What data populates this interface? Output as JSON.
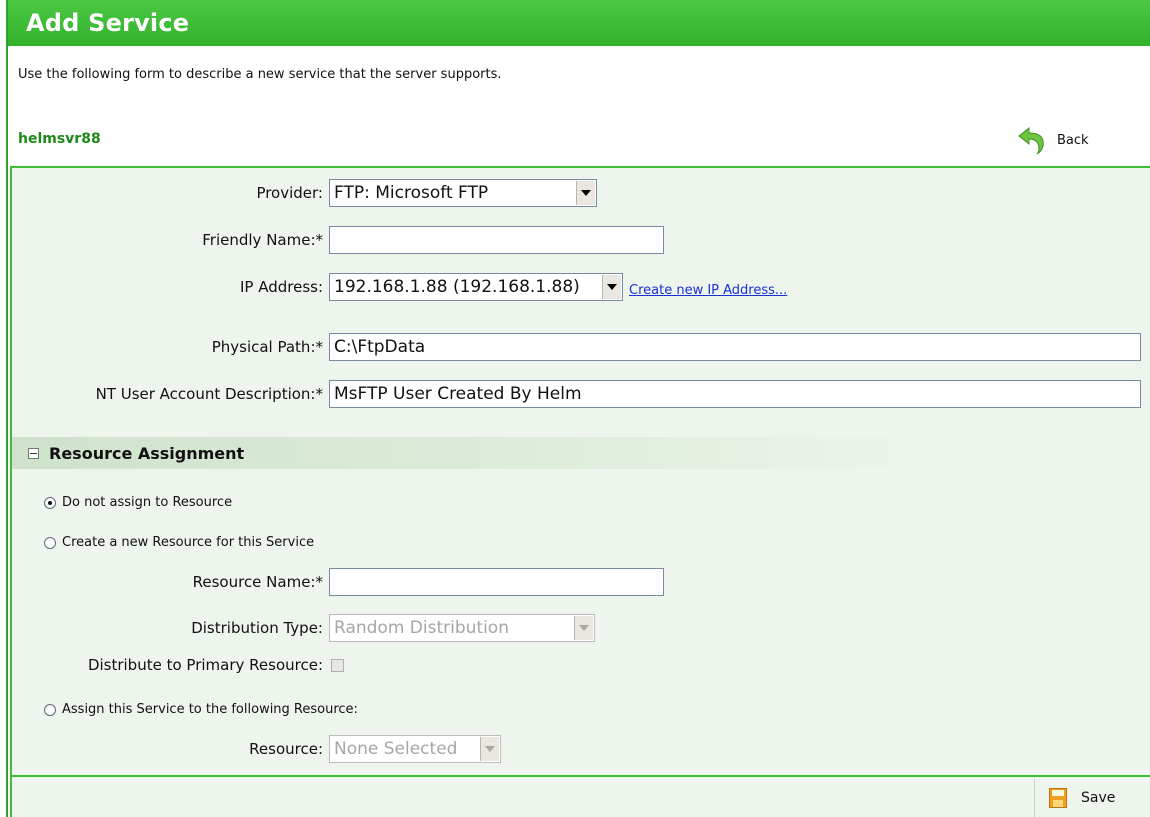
{
  "page": {
    "title": "Add Service",
    "description": "Use the following form to describe a new service that the server supports.",
    "server_name": "helmsvr88",
    "back_label": "Back"
  },
  "form": {
    "provider": {
      "label": "Provider:",
      "value": "FTP: Microsoft FTP"
    },
    "friendly_name": {
      "label": "Friendly Name:*",
      "value": ""
    },
    "ip_address": {
      "label": "IP Address:",
      "value": "192.168.1.88 (192.168.1.88)",
      "link": "Create new IP Address..."
    },
    "physical_path": {
      "label": "Physical Path:*",
      "value": "C:\\FtpData"
    },
    "nt_user": {
      "label": "NT User Account Description:*",
      "value": "MsFTP User Created By Helm"
    }
  },
  "resource": {
    "section_title": "Resource Assignment",
    "opt_none": "Do not assign to Resource",
    "opt_create": "Create a new Resource for this Service",
    "resource_name": {
      "label": "Resource Name:*",
      "value": ""
    },
    "distribution_type": {
      "label": "Distribution Type:",
      "value": "Random Distribution"
    },
    "distribute_primary": {
      "label": "Distribute to Primary Resource:"
    },
    "opt_assign": "Assign this Service to the following Resource:",
    "resource_select": {
      "label": "Resource:",
      "value": "None Selected"
    }
  },
  "footer": {
    "save_label": "Save"
  },
  "icons": [
    "back-arrow-icon",
    "save-icon",
    "collapse-icon",
    "dropdown-arrow-icon"
  ]
}
